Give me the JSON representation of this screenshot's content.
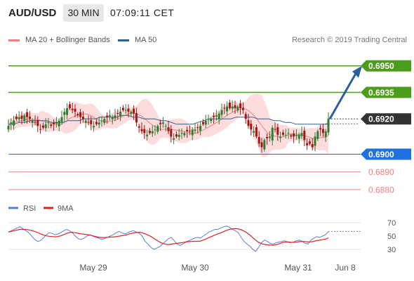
{
  "header": {
    "symbol": "AUD/USD",
    "timeframe": "30 MIN",
    "time": "07:09:11 CET"
  },
  "legend": {
    "ma20_label": "MA 20 + Bollinger Bands",
    "ma50_label": "MA 50",
    "credit": "Research © 2019 Trading Central",
    "rsi_label": "RSI",
    "ma9_label": "9MA"
  },
  "colors": {
    "green": "#4c9d1b",
    "blue": "#1e6fe0",
    "red": "#f08080",
    "dark": "#333333",
    "ma50": "#2f5f8f",
    "band": "#fcd6d6",
    "rsi": "#5b7fd8",
    "rsi_ma": "#e02020",
    "candle_up": "#2e7d32",
    "candle_down": "#a31515"
  },
  "chart_data": [
    {
      "type": "candlestick",
      "title": "AUD/USD",
      "timeframe": "30 MIN",
      "x_ticks": [
        "May 29",
        "May 30",
        "May 31",
        "Jun 8"
      ],
      "ylim": [
        0.6874,
        0.6961
      ],
      "price_levels": [
        {
          "value": 0.695,
          "label": "0.6950",
          "kind": "target"
        },
        {
          "value": 0.6935,
          "label": "0.6935",
          "kind": "target"
        },
        {
          "value": 0.692,
          "label": "0.6920",
          "kind": "last"
        },
        {
          "value": 0.69,
          "label": "0.6900",
          "kind": "pivot"
        },
        {
          "value": 0.689,
          "label": "0.6890",
          "kind": "support"
        },
        {
          "value": 0.688,
          "label": "0.6880",
          "kind": "support"
        }
      ],
      "close": [
        0.6916,
        0.6918,
        0.6919,
        0.692,
        0.6921,
        0.692,
        0.6922,
        0.6921,
        0.692,
        0.6919,
        0.6918,
        0.6916,
        0.6914,
        0.6915,
        0.6917,
        0.6918,
        0.6916,
        0.6917,
        0.6918,
        0.6919,
        0.6921,
        0.6924,
        0.6926,
        0.6926,
        0.6925,
        0.6924,
        0.6922,
        0.6921,
        0.692,
        0.6919,
        0.6918,
        0.6917,
        0.6916,
        0.6917,
        0.6918,
        0.6919,
        0.692,
        0.6921,
        0.6922,
        0.6921,
        0.6922,
        0.6923,
        0.6924,
        0.6925,
        0.6925,
        0.6924,
        0.6924,
        0.6923,
        0.6918,
        0.6915,
        0.6913,
        0.6912,
        0.6911,
        0.6912,
        0.6913,
        0.6914,
        0.6916,
        0.6917,
        0.6918,
        0.6916,
        0.6913,
        0.691,
        0.6909,
        0.691,
        0.6911,
        0.6912,
        0.6912,
        0.6913,
        0.6913,
        0.6914,
        0.6914,
        0.6915,
        0.6916,
        0.6917,
        0.6919,
        0.692,
        0.692,
        0.6921,
        0.6922,
        0.6923,
        0.6925,
        0.6926,
        0.6927,
        0.6926,
        0.6927,
        0.6926,
        0.6927,
        0.6926,
        0.6925,
        0.692,
        0.6916,
        0.6914,
        0.6913,
        0.691,
        0.6906,
        0.6904,
        0.6908,
        0.6909,
        0.691,
        0.6915,
        0.6914,
        0.6911,
        0.691,
        0.6911,
        0.6911,
        0.6912,
        0.691,
        0.691,
        0.6911,
        0.6911,
        0.6912,
        0.6908,
        0.6905,
        0.6906,
        0.6904,
        0.691,
        0.6913,
        0.6914,
        0.6912,
        0.6913,
        0.692
      ],
      "ma50": [
        0.6917,
        0.6917,
        0.6918,
        0.6918,
        0.6919,
        0.6919,
        0.6919,
        0.6919,
        0.6918,
        0.6918,
        0.6918,
        0.6919,
        0.6919,
        0.6919,
        0.692,
        0.692,
        0.692,
        0.6921,
        0.6921,
        0.6921,
        0.6921,
        0.6922,
        0.6922,
        0.6921,
        0.6921,
        0.692,
        0.692,
        0.692,
        0.6919,
        0.6919,
        0.6918,
        0.6917,
        0.6917,
        0.6917,
        0.6917,
        0.6918,
        0.6919,
        0.692,
        0.692,
        0.692,
        0.692,
        0.692,
        0.6921,
        0.6921,
        0.6921,
        0.6921,
        0.692,
        0.692,
        0.692,
        0.6919,
        0.6919,
        0.6918,
        0.6918,
        0.6917,
        0.6917,
        0.6917,
        0.6917,
        0.6917,
        0.6917,
        0.6917
      ],
      "rsi": {
        "ylim": [
          20,
          80
        ],
        "ticks": [
          30,
          50,
          70
        ],
        "values": [
          56,
          58,
          60,
          62,
          64,
          61,
          58,
          55,
          50,
          45,
          42,
          43,
          47,
          52,
          55,
          54,
          52,
          53,
          55,
          58,
          60,
          58,
          55,
          50,
          46,
          45,
          47,
          50,
          52,
          50,
          48,
          47,
          45,
          46,
          48,
          50,
          52,
          55,
          57,
          55,
          53,
          55,
          57,
          58,
          56,
          54,
          50,
          42,
          38,
          33,
          30,
          32,
          34,
          38,
          42,
          46,
          48,
          43,
          38,
          36,
          38,
          41,
          43,
          45,
          47,
          48,
          47,
          50,
          53,
          56,
          58,
          60,
          60,
          62,
          64,
          65,
          63,
          60,
          58,
          55,
          48,
          42,
          38,
          35,
          30,
          27,
          33,
          40,
          44,
          42,
          39,
          38,
          40,
          41,
          42,
          43,
          41,
          40,
          41,
          43,
          44,
          42,
          39,
          38,
          44,
          47,
          49,
          48,
          50,
          52,
          57
        ]
      }
    }
  ]
}
